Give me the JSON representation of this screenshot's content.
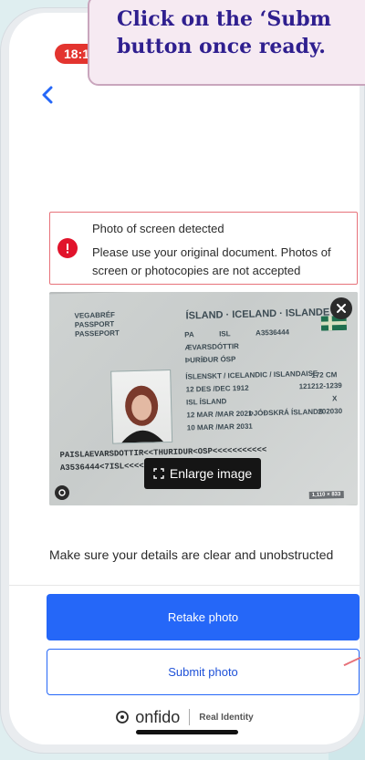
{
  "callout": {
    "line1": "Click on the ‘Subm",
    "line2": "button once ready."
  },
  "status_bar": {
    "time": "18:1"
  },
  "alert": {
    "title": "Photo of screen detected",
    "message": "Please use your original document. Photos of screen or photocopies are not accepted"
  },
  "document_preview": {
    "enlarge_label": "Enlarge image",
    "passport_header": "ÍSLAND · ICELAND · ISLANDE",
    "passport_labels": [
      "VEGABRÉF",
      "PASSPORT",
      "PASSEPORT"
    ],
    "passport_fields": [
      "PA",
      "ISL",
      "A3536444",
      "ÆVARSDÓTTIR",
      "ÞURÍÐUR ÓSP",
      "ÍSLENSKT / ICELANDIC / ISLANDAISE",
      "12 DES /DEC 1912",
      "ISL ÍSLAND",
      "12 MAR /MAR 2021",
      "10 MAR /MAR 2031",
      "172 CM",
      "121212-1239",
      "X",
      "ÞJÓÐSKRÁ ÍSLANDS",
      "202030"
    ],
    "mrz": [
      "PAISLAEVARSDOTTIR<<THURIDUR<OSP<<<<<<<<<<<",
      "A3536444<7ISL<<<<<<<<<<<<<<<<<<1239<<<68"
    ],
    "stamp": "1,110 × 833"
  },
  "instruction": "Make sure your details are clear and unobstructed",
  "buttons": {
    "retake": "Retake photo",
    "submit": "Submit photo"
  },
  "brand": {
    "name": "onfido",
    "tagline": "Real Identity"
  },
  "colors": {
    "primary": "#2567f8",
    "alert_border": "#e7727a",
    "alert_icon": "#e1132b",
    "callout_text": "#2f1f8f"
  }
}
